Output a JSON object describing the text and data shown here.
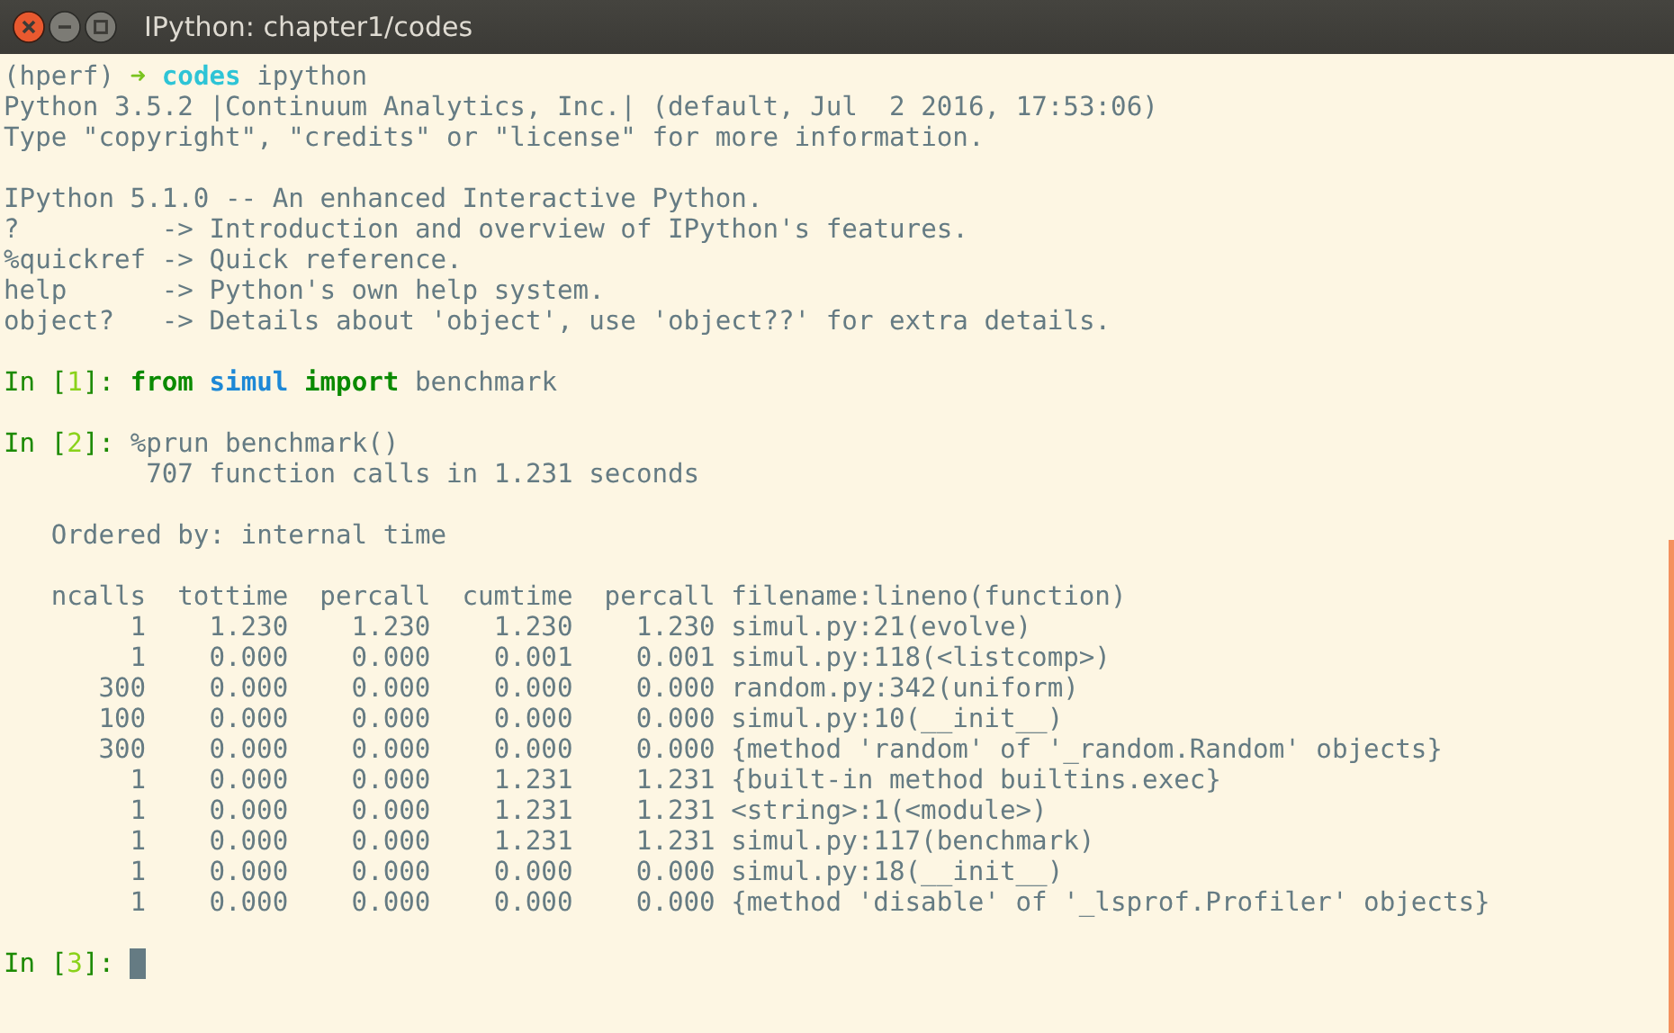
{
  "window": {
    "title": "IPython: chapter1/codes"
  },
  "terminal": [
    {
      "kind": "text",
      "lines": [
        {
          "segments": [
            {
              "kind": "plain",
              "text": "(hperf)"
            },
            {
              "kind": "arrow",
              "text": "➜"
            },
            {
              "kind": "dir",
              "text": "codes"
            },
            {
              "kind": "plain",
              "text": "ipython"
            }
          ]
        },
        {
          "segments": [
            {
              "kind": "plain",
              "text": "Python 3.5.2 |Continuum Analytics, Inc.| (default, Jul  2 2016, 17:53:06)"
            }
          ]
        },
        {
          "segments": [
            {
              "kind": "plain",
              "text": "Type \"copyright\", \"credits\" or \"license\" for more information."
            }
          ]
        }
      ]
    },
    {
      "kind": "text",
      "lines": [
        {
          "segments": [
            {
              "kind": "plain",
              "text": "IPython 5.1.0 -- An enhanced Interactive Python."
            }
          ]
        },
        {
          "segments": [
            {
              "kind": "plain",
              "text": "?         -> Introduction and overview of IPython's features."
            }
          ]
        },
        {
          "segments": [
            {
              "kind": "plain",
              "text": "%quickref -> Quick reference."
            }
          ]
        },
        {
          "segments": [
            {
              "kind": "plain",
              "text": "help      -> Python's own help system."
            }
          ]
        },
        {
          "segments": [
            {
              "kind": "plain",
              "text": "object?   -> Details about 'object', use 'object??' for extra details."
            }
          ]
        }
      ]
    },
    {
      "kind": "text",
      "lines": [
        {
          "segments": [
            {
              "kind": "prompt",
              "open": "In [",
              "number": "1",
              "close": "]:"
            },
            {
              "kind": "keyword",
              "text": "from"
            },
            {
              "kind": "module",
              "text": "simul"
            },
            {
              "kind": "keyword",
              "text": "import"
            },
            {
              "kind": "plain",
              "text": "benchmark"
            }
          ]
        }
      ]
    },
    {
      "kind": "text",
      "lines": [
        {
          "segments": [
            {
              "kind": "prompt",
              "open": "In [",
              "number": "2",
              "close": "]:"
            },
            {
              "kind": "plain",
              "text": "%prun benchmark()"
            }
          ]
        },
        {
          "segments": [
            {
              "kind": "plain",
              "text": "         707 function calls in 1.231 seconds"
            }
          ]
        }
      ]
    },
    {
      "kind": "text",
      "lines": [
        {
          "segments": [
            {
              "kind": "plain",
              "text": "   Ordered by: internal time"
            }
          ]
        }
      ]
    },
    {
      "kind": "profile_table",
      "columns": [
        "ncalls",
        "tottime",
        "percall",
        "cumtime",
        "percall",
        "filename:lineno(function)"
      ],
      "rows": [
        [
          "1",
          "1.230",
          "1.230",
          "1.230",
          "1.230",
          "simul.py:21(evolve)"
        ],
        [
          "1",
          "0.000",
          "0.000",
          "0.001",
          "0.001",
          "simul.py:118(<listcomp>)"
        ],
        [
          "300",
          "0.000",
          "0.000",
          "0.000",
          "0.000",
          "random.py:342(uniform)"
        ],
        [
          "100",
          "0.000",
          "0.000",
          "0.000",
          "0.000",
          "simul.py:10(__init__)"
        ],
        [
          "300",
          "0.000",
          "0.000",
          "0.000",
          "0.000",
          "{method 'random' of '_random.Random' objects}"
        ],
        [
          "1",
          "0.000",
          "0.000",
          "1.231",
          "1.231",
          "{built-in method builtins.exec}"
        ],
        [
          "1",
          "0.000",
          "0.000",
          "1.231",
          "1.231",
          "<string>:1(<module>)"
        ],
        [
          "1",
          "0.000",
          "0.000",
          "1.231",
          "1.231",
          "simul.py:117(benchmark)"
        ],
        [
          "1",
          "0.000",
          "0.000",
          "0.000",
          "0.000",
          "simul.py:18(__init__)"
        ],
        [
          "1",
          "0.000",
          "0.000",
          "0.000",
          "0.000",
          "{method 'disable' of '_lsprof.Profiler' objects}"
        ]
      ]
    },
    {
      "kind": "text",
      "lines": [
        {
          "cursor": true,
          "segments": [
            {
              "kind": "prompt",
              "open": "In [",
              "number": "3",
              "close": "]:"
            }
          ]
        }
      ]
    }
  ]
}
